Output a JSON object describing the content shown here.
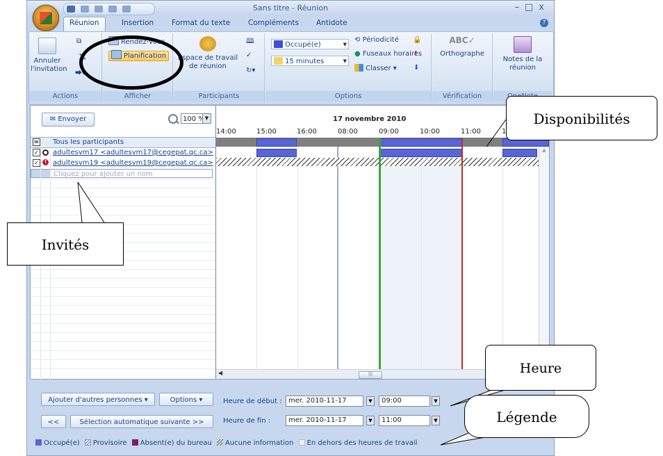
{
  "window": {
    "title": "Sans titre - Réunion"
  },
  "tabs": [
    "Réunion",
    "Insertion",
    "Format du texte",
    "Compléments",
    "Antidote"
  ],
  "ribbon": {
    "actions": {
      "cancel_label": "Annuler l'invitation",
      "group_label": "Actions"
    },
    "afficher": {
      "rdv_label": "Rendez-vous",
      "plan_label": "Planification",
      "group_label": "Afficher"
    },
    "participants": {
      "workspace_label": "Espace de travail de réunion",
      "group_label": "Participants"
    },
    "options": {
      "busy_value": "Occupé(e)",
      "reminder_value": "15 minutes",
      "recurrence_label": "Périodicité",
      "timezones_label": "Fuseaux horaires",
      "classify_label": "Classer",
      "group_label": "Options"
    },
    "verification": {
      "spelling_label": "Orthographe",
      "group_label": "Vérification"
    },
    "onenote": {
      "notes_label": "Notes de la réunion",
      "group_label": "OneNote"
    }
  },
  "scheduler": {
    "send_label": "Envoyer",
    "zoom_value": "100 %",
    "all_participants": "Tous les participants",
    "attendees": [
      {
        "name": "adultesvm17 <adultesvm17@cegepat.qc.ca>"
      },
      {
        "name": "adultesvm19 <adultesvm19@cegepat.qc.ca>"
      }
    ],
    "add_name_placeholder": "Cliquez pour ajouter un nom",
    "date_label": "17 novembre 2010",
    "hours_left": [
      "14:00",
      "15:00",
      "16:00"
    ],
    "hours_right": [
      "08:00",
      "09:00",
      "10:00",
      "11:00",
      "1"
    ]
  },
  "bottom": {
    "add_people_label": "Ajouter d'autres personnes",
    "options_label": "Options",
    "prev_label": "<<",
    "autopick_label": "Sélection automatique suivante >>",
    "start_label": "Heure de début :",
    "end_label": "Heure de fin :",
    "start_date": "mer. 2010-11-17",
    "start_time": "09:00",
    "end_date": "mer. 2010-11-17",
    "end_time": "11:00"
  },
  "legend": {
    "busy": "Occupé(e)",
    "tentative": "Provisoire",
    "away": "Absent(e) du bureau",
    "noinfo": "Aucune information",
    "offhours": "En dehors des heures de travail",
    "colors": {
      "busy": "#5865d5",
      "away": "#7b1a6a"
    }
  },
  "callouts": {
    "disponibilites": "Disponibilités",
    "invites": "Invités",
    "heure": "Heure",
    "legende": "Légende"
  }
}
